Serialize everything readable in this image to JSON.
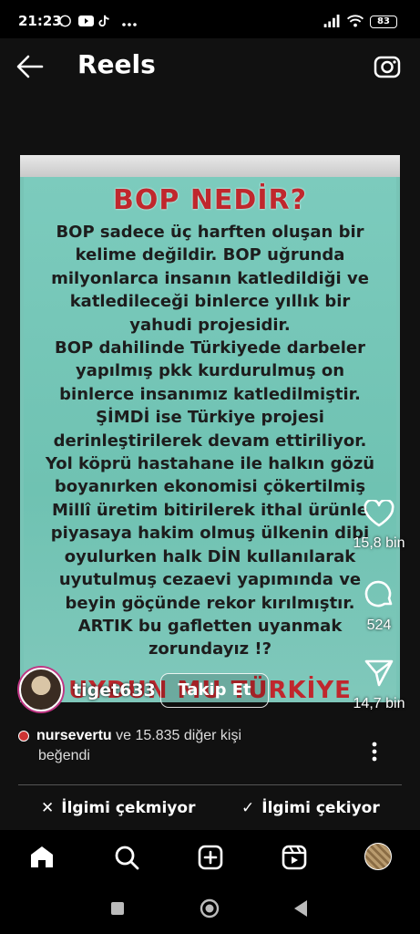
{
  "status": {
    "time": "21:23",
    "battery": "83",
    "left_icons": [
      "whatsapp-icon",
      "youtube-icon",
      "tiktok-icon",
      "more-dots-icon"
    ],
    "right_icons": [
      "signal-icon",
      "wifi-icon",
      "battery-icon"
    ]
  },
  "header": {
    "title": "Reels"
  },
  "reel": {
    "heading": "BOP NEDİR?",
    "lines": [
      "BOP sadece üç harften oluşan bir",
      "kelime değildir. BOP uğrunda",
      "milyonlarca insanın katledildiği ve",
      "katledileceği binlerce yıllık bir",
      "yahudi projesidir.",
      "BOP dahilinde Türkiyede darbeler",
      "yapılmış pkk kurdurulmuş on",
      "binlerce insanımız katledilmiştir.",
      "ŞİMDİ ise Türkiye projesi",
      "derinleştirilerek devam ettiriliyor.",
      "Yol köprü hastahane ile halkın gözü",
      "boyanırken ekonomisi çökertilmiş",
      "Millî üretim bitirilerek ithal ürünle",
      "piyasaya hakim olmuş ülkenin dibi",
      "oyulurken halk DİN kullanılarak",
      "uyutulmuş cezaevi yapımında ve",
      "beyin göçünde rekor kırılmıştır.",
      "ARTIK bu gafletten  uyanmak",
      "zorundayız !?"
    ],
    "footer": "UYDUN MU TÜRKİYE"
  },
  "actions": {
    "likes": "15,8 bin",
    "comments": "524",
    "shares": "14,7 bin"
  },
  "user": {
    "username": "tiget633",
    "follow_label": "Takip Et"
  },
  "likers": {
    "name": "nursevertu",
    "rest": " ve 15.835 diğer kişi",
    "line2": "beğendi"
  },
  "choices": {
    "not_interested": "İlgimi çekmiyor",
    "interested": "İlgimi çekiyor"
  },
  "colors": {
    "heading_red": "#c0272d",
    "reel_bg": "#78c4b6"
  }
}
